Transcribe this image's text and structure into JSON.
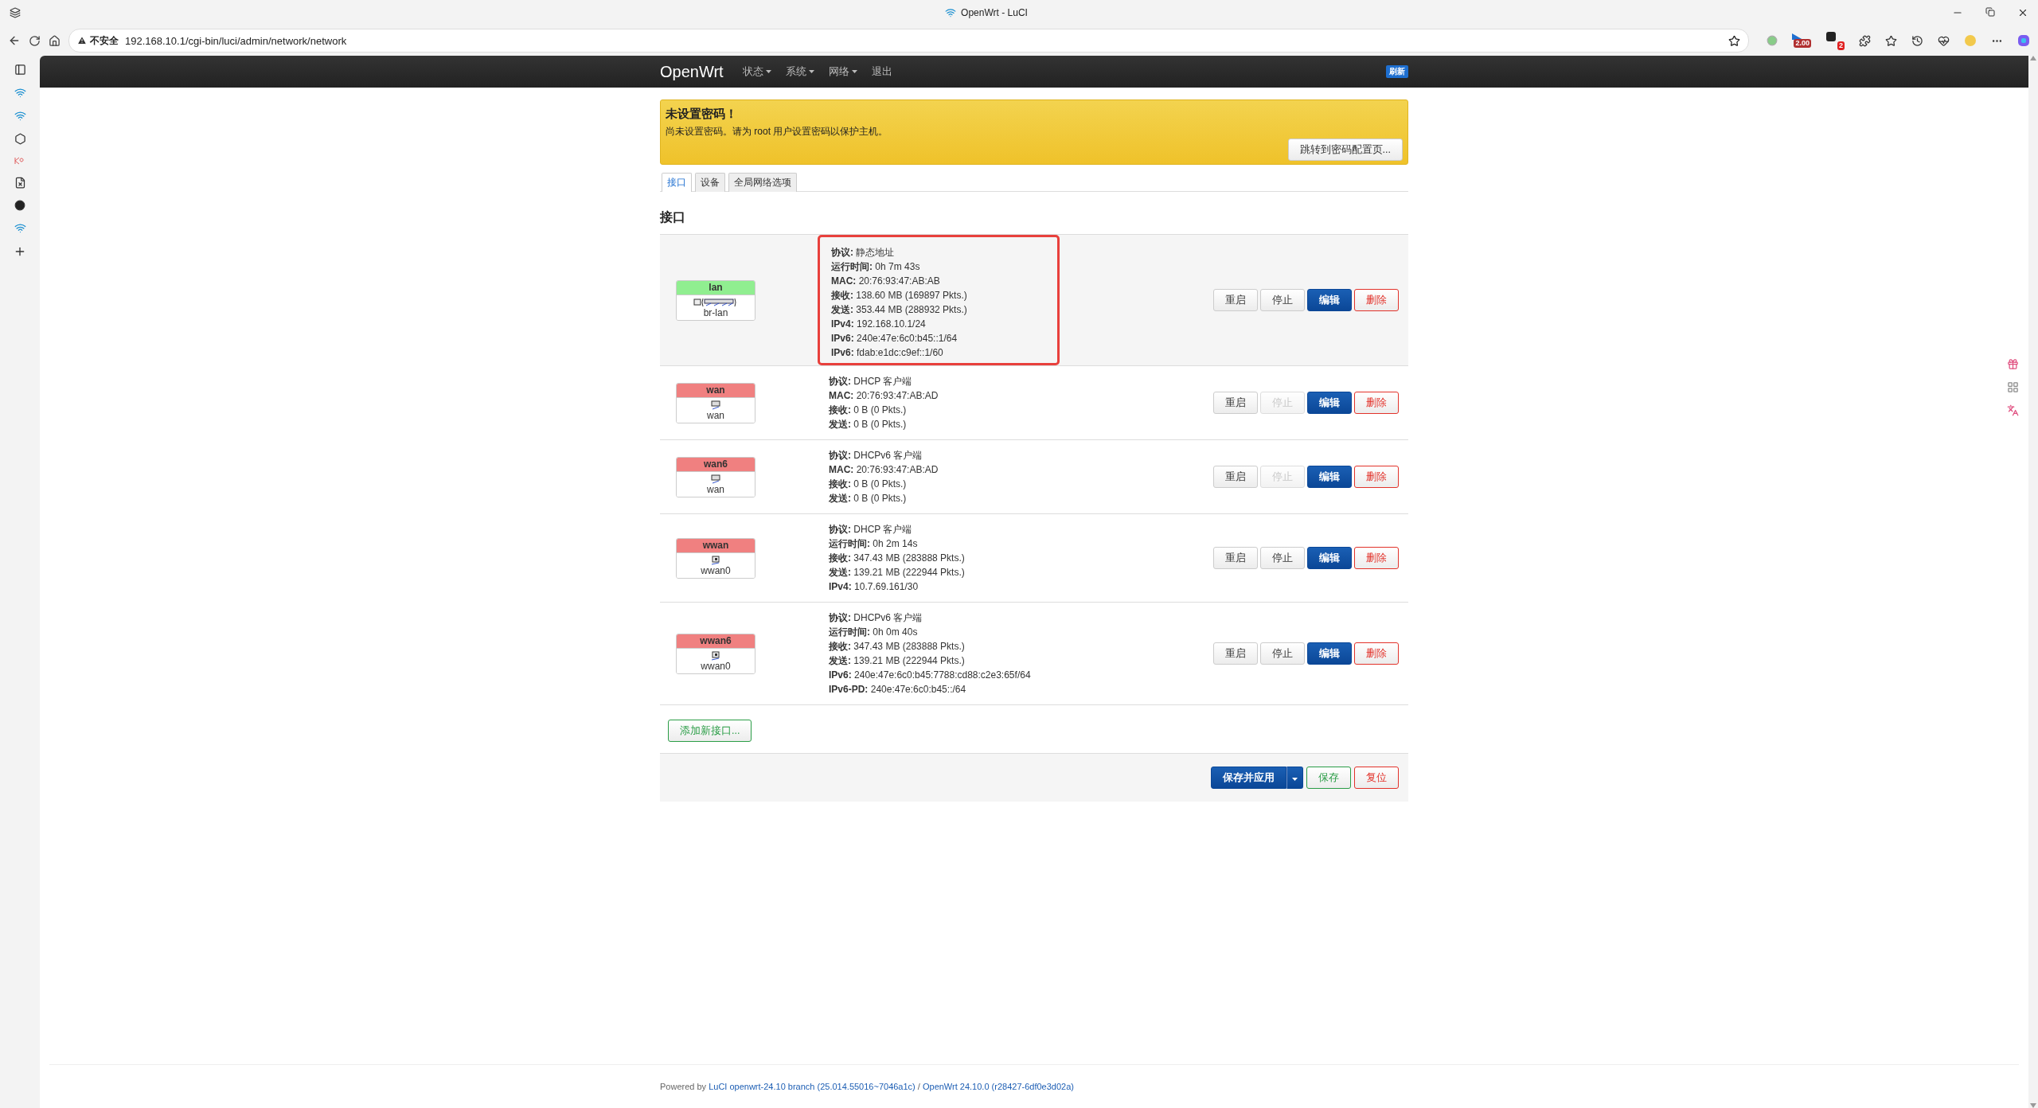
{
  "browser": {
    "tab_title": "OpenWrt - LuCI",
    "security_label": "不安全",
    "url": "192.168.10.1/cgi-bin/luci/admin/network/network",
    "extension_badges": [
      "2.00",
      "2"
    ]
  },
  "header": {
    "brand": "OpenWrt",
    "menu": [
      {
        "label": "状态",
        "has_dropdown": true
      },
      {
        "label": "系统",
        "has_dropdown": true
      },
      {
        "label": "网络",
        "has_dropdown": true
      },
      {
        "label": "退出",
        "has_dropdown": false
      }
    ],
    "refresh_badge": "刷新"
  },
  "alert": {
    "title": "未设置密码！",
    "message": "尚未设置密码。请为 root 用户设置密码以保护主机。",
    "button": "跳转到密码配置页..."
  },
  "tabs": [
    {
      "label": "接口",
      "selected": true
    },
    {
      "label": "设备",
      "selected": false
    },
    {
      "label": "全局网络选项",
      "selected": false
    }
  ],
  "section_title": "接口",
  "interfaces": [
    {
      "name": "lan",
      "color": "#90ee90",
      "device": "br-lan",
      "kind": "bridge",
      "highlighted": true,
      "info": [
        {
          "label": "协议:",
          "value": "静态地址"
        },
        {
          "label": "运行时间:",
          "value": "0h 7m 43s"
        },
        {
          "label": "MAC:",
          "value": "20:76:93:47:AB:AB"
        },
        {
          "label": "接收:",
          "value": "138.60 MB (169897 Pkts.)"
        },
        {
          "label": "发送:",
          "value": "353.44 MB (288932 Pkts.)"
        },
        {
          "label": "IPv4:",
          "value": "192.168.10.1/24"
        },
        {
          "label": "IPv6:",
          "value": "240e:47e:6c0:b45::1/64"
        },
        {
          "label": "IPv6:",
          "value": "fdab:e1dc:c9ef::1/60"
        }
      ],
      "actions": [
        {
          "label": "重启",
          "kind": "neutral",
          "disabled": false
        },
        {
          "label": "停止",
          "kind": "neutral",
          "disabled": false
        },
        {
          "label": "编辑",
          "kind": "primary",
          "disabled": false
        },
        {
          "label": "删除",
          "kind": "danger",
          "disabled": false
        }
      ]
    },
    {
      "name": "wan",
      "color": "#f08080",
      "device": "wan",
      "kind": "port",
      "highlighted": false,
      "info": [
        {
          "label": "协议:",
          "value": "DHCP 客户端"
        },
        {
          "label": "MAC:",
          "value": "20:76:93:47:AB:AD"
        },
        {
          "label": "接收:",
          "value": "0 B (0 Pkts.)"
        },
        {
          "label": "发送:",
          "value": "0 B (0 Pkts.)"
        }
      ],
      "actions": [
        {
          "label": "重启",
          "kind": "neutral",
          "disabled": false
        },
        {
          "label": "停止",
          "kind": "neutral",
          "disabled": true
        },
        {
          "label": "编辑",
          "kind": "primary",
          "disabled": false
        },
        {
          "label": "删除",
          "kind": "danger",
          "disabled": false
        }
      ]
    },
    {
      "name": "wan6",
      "color": "#f08080",
      "device": "wan",
      "kind": "port",
      "highlighted": false,
      "info": [
        {
          "label": "协议:",
          "value": "DHCPv6 客户端"
        },
        {
          "label": "MAC:",
          "value": "20:76:93:47:AB:AD"
        },
        {
          "label": "接收:",
          "value": "0 B (0 Pkts.)"
        },
        {
          "label": "发送:",
          "value": "0 B (0 Pkts.)"
        }
      ],
      "actions": [
        {
          "label": "重启",
          "kind": "neutral",
          "disabled": false
        },
        {
          "label": "停止",
          "kind": "neutral",
          "disabled": true
        },
        {
          "label": "编辑",
          "kind": "primary",
          "disabled": false
        },
        {
          "label": "删除",
          "kind": "danger",
          "disabled": false
        }
      ]
    },
    {
      "name": "wwan",
      "color": "#f08080",
      "device": "wwan0",
      "kind": "usb",
      "highlighted": false,
      "info": [
        {
          "label": "协议:",
          "value": "DHCP 客户端"
        },
        {
          "label": "运行时间:",
          "value": "0h 2m 14s"
        },
        {
          "label": "接收:",
          "value": "347.43 MB (283888 Pkts.)"
        },
        {
          "label": "发送:",
          "value": "139.21 MB (222944 Pkts.)"
        },
        {
          "label": "IPv4:",
          "value": "10.7.69.161/30"
        }
      ],
      "actions": [
        {
          "label": "重启",
          "kind": "neutral",
          "disabled": false
        },
        {
          "label": "停止",
          "kind": "neutral",
          "disabled": false
        },
        {
          "label": "编辑",
          "kind": "primary",
          "disabled": false
        },
        {
          "label": "删除",
          "kind": "danger",
          "disabled": false
        }
      ]
    },
    {
      "name": "wwan6",
      "color": "#f08080",
      "device": "wwan0",
      "kind": "usb",
      "highlighted": false,
      "info": [
        {
          "label": "协议:",
          "value": "DHCPv6 客户端"
        },
        {
          "label": "运行时间:",
          "value": "0h 0m 40s"
        },
        {
          "label": "接收:",
          "value": "347.43 MB (283888 Pkts.)"
        },
        {
          "label": "发送:",
          "value": "139.21 MB (222944 Pkts.)"
        },
        {
          "label": "IPv6:",
          "value": "240e:47e:6c0:b45:7788:cd88:c2e3:65f/64"
        },
        {
          "label": "IPv6-PD:",
          "value": "240e:47e:6c0:b45::/64"
        }
      ],
      "actions": [
        {
          "label": "重启",
          "kind": "neutral",
          "disabled": false
        },
        {
          "label": "停止",
          "kind": "neutral",
          "disabled": false
        },
        {
          "label": "编辑",
          "kind": "primary",
          "disabled": false
        },
        {
          "label": "删除",
          "kind": "danger",
          "disabled": false
        }
      ]
    }
  ],
  "add_button": "添加新接口...",
  "form_actions": [
    {
      "label": "保存并应用",
      "kind": "primary",
      "has_dropdown": true
    },
    {
      "label": "保存",
      "kind": "positive",
      "has_dropdown": false
    },
    {
      "label": "复位",
      "kind": "danger",
      "has_dropdown": false
    }
  ],
  "footer": {
    "prefix": "Powered by",
    "luci_link": "LuCI openwrt-24.10 branch (25.014.55016~7046a1c)",
    "separator": "/",
    "openwrt_link": "OpenWrt 24.10.0 (r28427-6df0e3d02a)"
  }
}
